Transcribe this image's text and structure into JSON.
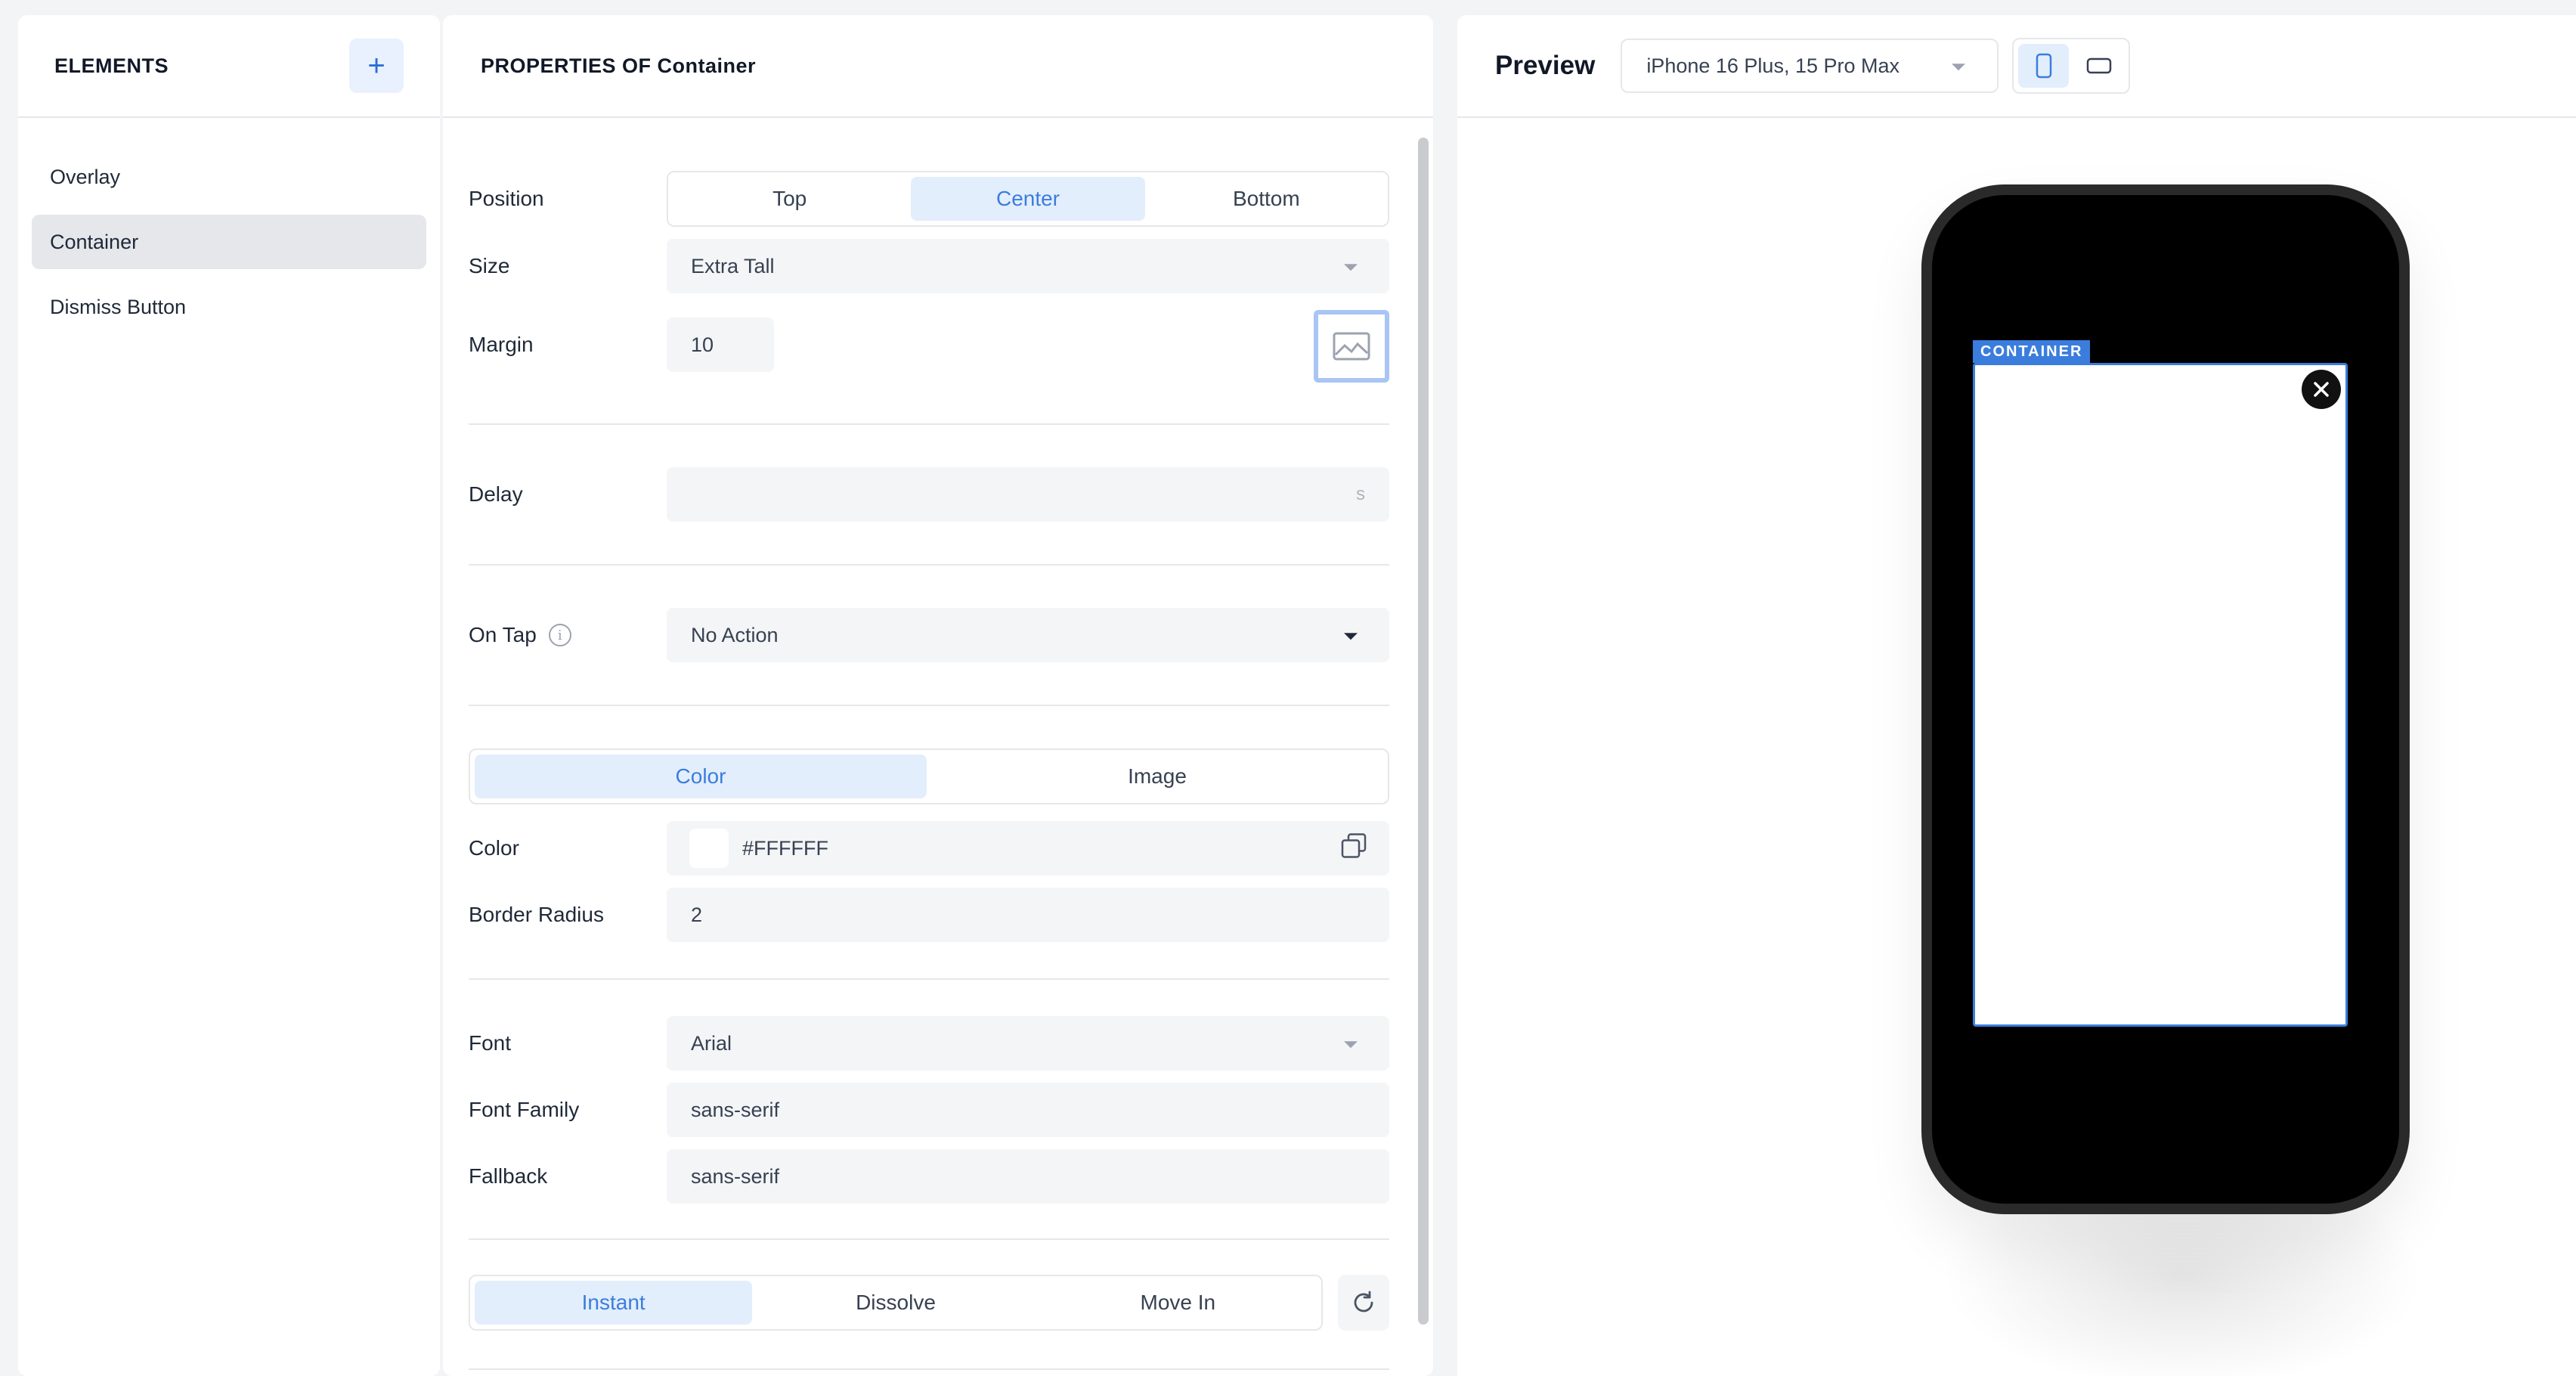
{
  "elements_panel": {
    "title": "ELEMENTS",
    "add_label": "+",
    "items": [
      {
        "label": "Overlay"
      },
      {
        "label": "Container"
      },
      {
        "label": "Dismiss Button"
      }
    ],
    "selected": "Container"
  },
  "properties_panel": {
    "title": "PROPERTIES OF Container",
    "position": {
      "label": "Position",
      "options": [
        "Top",
        "Center",
        "Bottom"
      ],
      "selected": "Center"
    },
    "size": {
      "label": "Size",
      "value": "Extra Tall"
    },
    "margin": {
      "label": "Margin",
      "value": "10"
    },
    "delay": {
      "label": "Delay",
      "value": "",
      "suffix": "s"
    },
    "on_tap": {
      "label": "On Tap",
      "info_icon": "info-icon",
      "value": "No Action"
    },
    "background_mode": {
      "options": [
        "Color",
        "Image"
      ],
      "selected": "Color"
    },
    "color": {
      "label": "Color",
      "value": "#FFFFFF",
      "swatch": "#FFFFFF"
    },
    "border_radius": {
      "label": "Border Radius",
      "value": "2"
    },
    "font": {
      "label": "Font",
      "value": "Arial"
    },
    "font_family": {
      "label": "Font Family",
      "value": "sans-serif"
    },
    "fallback": {
      "label": "Fallback",
      "value": "sans-serif"
    },
    "animation": {
      "options": [
        "Instant",
        "Dissolve",
        "Move In"
      ],
      "selected": "Instant"
    }
  },
  "preview_panel": {
    "title": "Preview",
    "device": "iPhone 16 Plus, 15 Pro Max",
    "orientation_selected": "portrait",
    "container_tag": "CONTAINER"
  },
  "colors": {
    "accent": "#3B7DDD",
    "accent_bg": "#E3EEFC",
    "selected_item_bg": "#E5E7EB",
    "phone_body": "#000000"
  }
}
